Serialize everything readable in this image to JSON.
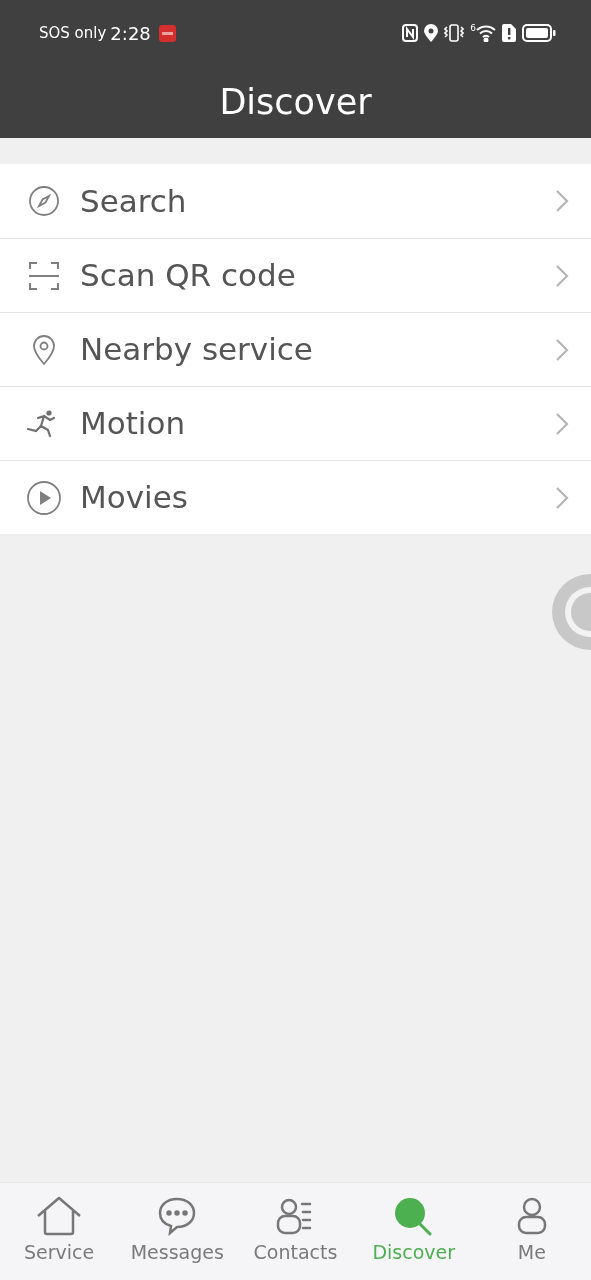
{
  "status_bar": {
    "carrier": "SOS only",
    "time": "2:28",
    "wifi_generation": "6"
  },
  "header": {
    "title": "Discover"
  },
  "menu": [
    {
      "kind": "compass",
      "label": "Search"
    },
    {
      "kind": "scan",
      "label": "Scan QR code"
    },
    {
      "kind": "pin",
      "label": "Nearby service"
    },
    {
      "kind": "runner",
      "label": "Motion"
    },
    {
      "kind": "play",
      "label": "Movies"
    }
  ],
  "tabs": [
    {
      "kind": "home",
      "label": "Service",
      "selected": false
    },
    {
      "kind": "chat",
      "label": "Messages",
      "selected": false
    },
    {
      "kind": "contacts",
      "label": "Contacts",
      "selected": false
    },
    {
      "kind": "search",
      "label": "Discover",
      "selected": true
    },
    {
      "kind": "person",
      "label": "Me",
      "selected": false
    }
  ]
}
